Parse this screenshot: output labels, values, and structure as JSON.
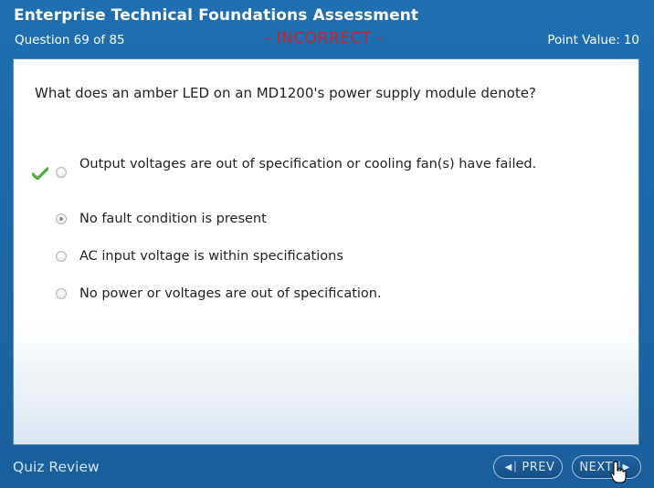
{
  "header": {
    "title": "Enterprise Technical Foundations Assessment",
    "question_counter": "Question 69 of 85",
    "status": "- INCORRECT -",
    "point_label": "Point Value:",
    "point_value": "10"
  },
  "question": {
    "text": "What does an amber LED on an MD1200's power supply module denote?",
    "options": [
      {
        "label": "Output voltages are out of specification or cooling fan(s) have failed.",
        "correct": true,
        "selected": false
      },
      {
        "label": "No fault condition is present",
        "correct": false,
        "selected": true
      },
      {
        "label": "AC input voltage is within specifications",
        "correct": false,
        "selected": false
      },
      {
        "label": "No power or voltages are out of specification.",
        "correct": false,
        "selected": false
      }
    ]
  },
  "footer": {
    "label": "Quiz Review",
    "prev_label": "PREV",
    "next_label": "NEXT"
  },
  "icons": {
    "correct_mark": "checkmark-icon",
    "prev": "prev-arrow-icon",
    "next": "next-arrow-icon"
  },
  "colors": {
    "frame": "#1c67a8",
    "status_incorrect": "#c8242b",
    "check_green": "#4caf35"
  }
}
